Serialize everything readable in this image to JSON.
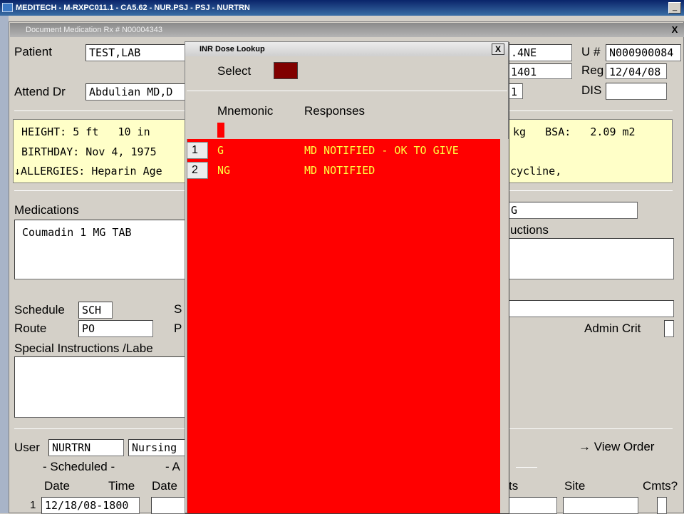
{
  "app": {
    "title": "MEDITECH - M-RXPC011.1 - CA5.62 - NUR.PSJ - PSJ - NURTRN",
    "minimize": "_"
  },
  "doc": {
    "title": "Document Medication Rx # N00004343",
    "close": "X"
  },
  "header": {
    "patient_label": "Patient",
    "patient_value": "TEST,LAB",
    "location_value": ".4NE",
    "u_label": "U #",
    "u_value": "N000900084",
    "room_value": "1401",
    "reg_label": "Reg",
    "reg_value": "12/04/08",
    "attend_label": "Attend Dr",
    "attend_value": "Abdulian MD,D",
    "bed_value": "1",
    "dis_label": "DIS",
    "dis_value": ""
  },
  "patient_info": {
    "line1_left": "HEIGHT: 5 ft   10 in",
    "line1_right": "kg   BSA:   2.09 m2",
    "line2_left": "BIRTHDAY: Nov 4, 1975",
    "line3_left": "↓ALLERGIES: Heparin Age",
    "line3_right": "cycline,"
  },
  "medications": {
    "label": "Medications",
    "value": "Coumadin 1 MG TAB",
    "dose_value": "G",
    "instructions_label": "uctions"
  },
  "schedule": {
    "schedule_label": "Schedule",
    "schedule_value": "SCH",
    "s_label": "S",
    "route_label": "Route",
    "route_value": "PO",
    "p_label": "P",
    "admin_crit_label": "Admin Crit",
    "special_label": "Special Instructions /Labe"
  },
  "footer": {
    "user_label": "User",
    "user_value": "NURTRN",
    "nursing_value": "Nursing",
    "view_order": "→ View Order",
    "scheduled_label": "- Scheduled -",
    "a_label": "- A",
    "date_label": "Date",
    "time_label": "Time",
    "date2_label": "Date",
    "ts_label": "ts",
    "site_label": "Site",
    "cmts_label": "Cmts?",
    "row1_num": "1",
    "row1_value": "12/18/08-1800"
  },
  "popup": {
    "title": "INR Dose Lookup",
    "close": "X",
    "select_label": "Select",
    "col_mnemonic": "Mnemonic",
    "col_responses": "Responses",
    "rows": [
      {
        "num": "1",
        "mnemonic": "G",
        "response": "MD NOTIFIED - OK TO GIVE"
      },
      {
        "num": "2",
        "mnemonic": "NG",
        "response": "MD NOTIFIED"
      }
    ]
  },
  "colors": {
    "list_bg": "#ff0000",
    "list_text": "#ffff40",
    "patient_panel": "#ffffc8"
  }
}
